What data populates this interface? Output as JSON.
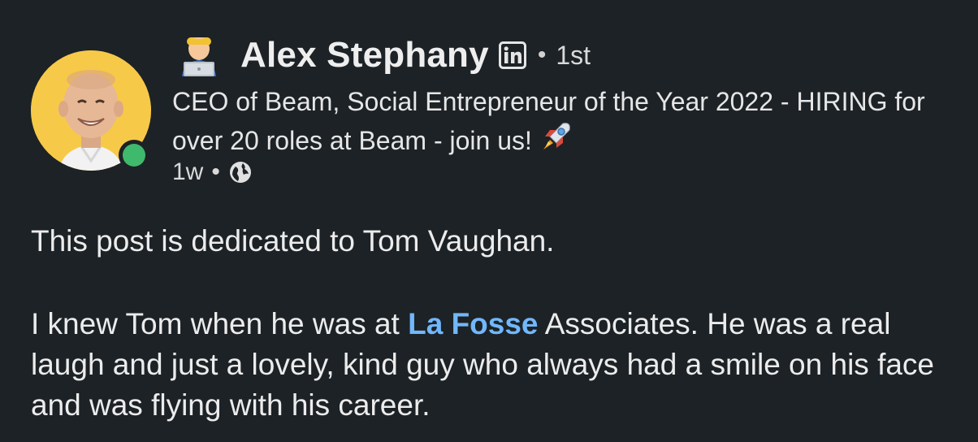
{
  "author": {
    "name": "Alex Stephany",
    "degree": "1st",
    "separator": "•",
    "headline": "CEO of Beam, Social Entrepreneur of the Year 2022 - HIRING for over 20 roles at Beam - join us!",
    "headline_emoji": "rocket-icon",
    "name_emoji": "technologist-icon",
    "badge": "linkedin-icon",
    "online": true
  },
  "meta": {
    "time": "1w",
    "separator": "•",
    "visibility": "globe-icon"
  },
  "post": {
    "line1": "This post is dedicated to Tom Vaughan.",
    "para2_before": "I knew Tom when he was at ",
    "mention": "La Fosse",
    "para2_after": " Associates. He was a real laugh and just a lovely, kind guy who always had a smile on his face and was flying with his career."
  },
  "colors": {
    "background": "#1d2226",
    "mention": "#71b7fb",
    "online": "#3fb96b",
    "avatar_bg": "#f7c948"
  }
}
